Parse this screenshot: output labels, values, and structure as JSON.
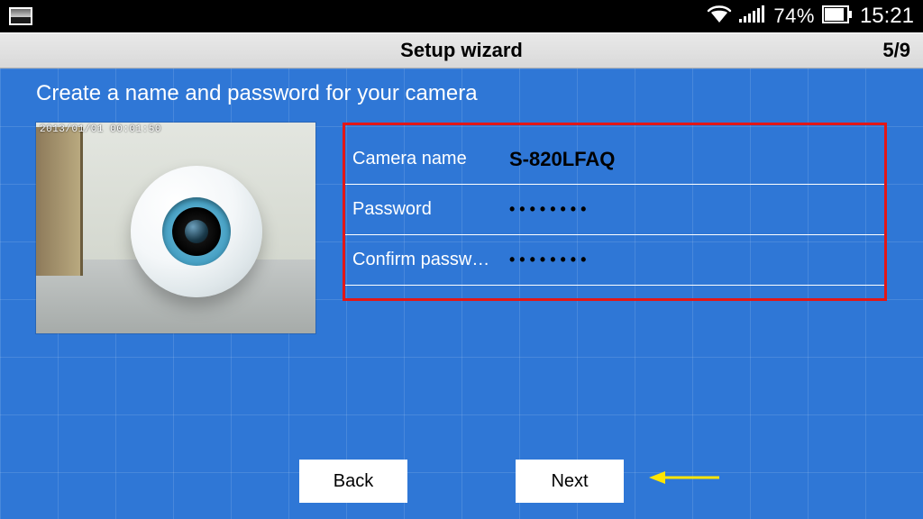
{
  "status": {
    "battery_pct": "74%",
    "clock": "15:21"
  },
  "title_bar": {
    "title": "Setup wizard",
    "step": "5/9"
  },
  "heading": "Create a name and password for your camera",
  "camera": {
    "timestamp": "2013/01/01  00:01:50"
  },
  "form": {
    "camera_name_label": "Camera name",
    "camera_name_value": "S-820LFAQ",
    "password_label": "Password",
    "password_dots": "••••••••",
    "confirm_label": "Confirm passw…",
    "confirm_dots": "••••••••"
  },
  "buttons": {
    "back": "Back",
    "next": "Next"
  }
}
